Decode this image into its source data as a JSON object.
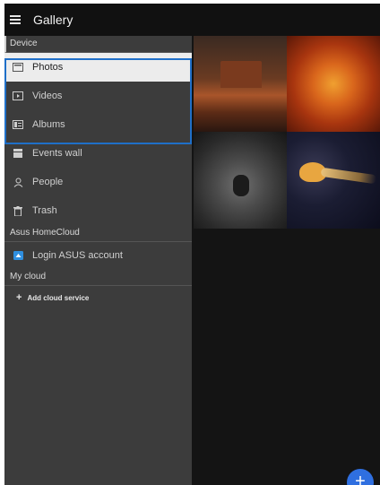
{
  "appbar": {
    "title": "Gallery",
    "menu_icon": "hamburger-menu-icon"
  },
  "drawer": {
    "device_header": "Device",
    "device_items": [
      {
        "label": "Photos",
        "icon": "photos-icon",
        "selected": true
      },
      {
        "label": "Videos",
        "icon": "videos-icon",
        "selected": false
      },
      {
        "label": "Albums",
        "icon": "albums-icon",
        "selected": false
      },
      {
        "label": "Events wall",
        "icon": "events-wall-icon",
        "selected": false
      },
      {
        "label": "People",
        "icon": "people-icon",
        "selected": false
      },
      {
        "label": "Trash",
        "icon": "trash-icon",
        "selected": false
      }
    ],
    "asus_header": "Asus HomeCloud",
    "asus_login": {
      "label": "Login ASUS account",
      "icon": "asus-homecloud-icon"
    },
    "mycloud_header": "My cloud",
    "add_cloud": {
      "label": "Add cloud service",
      "icon": "plus-icon"
    }
  },
  "photos": [
    "desert-photo",
    "flower-photo",
    "koala-photo",
    "jellyfish-photo"
  ],
  "fab_icon": "add-icon",
  "colors": {
    "highlight": "#1f6fc8",
    "drawer_bg": "#3c3c3c",
    "fab": "#2f6fe0"
  }
}
